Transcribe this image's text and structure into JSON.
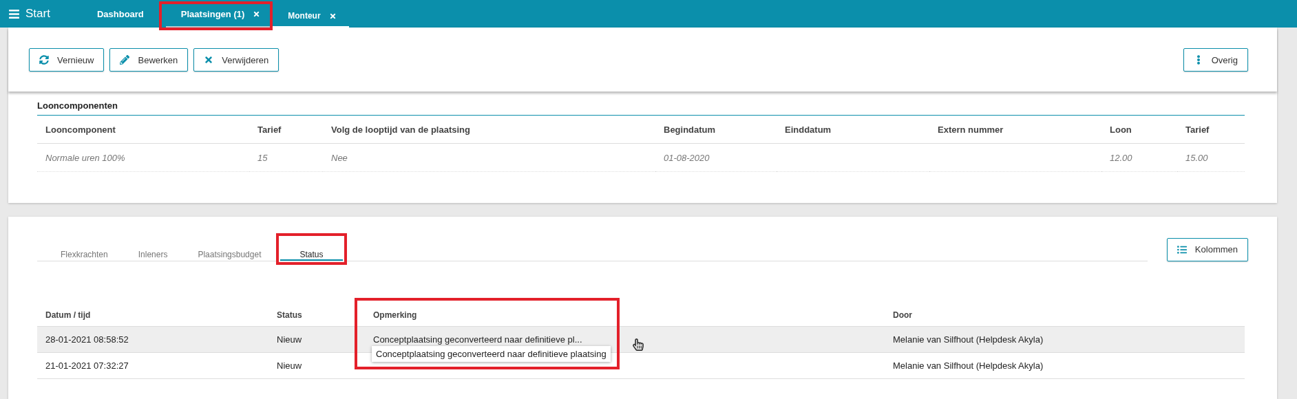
{
  "app_bar": {
    "menu_label": "Start",
    "tabs": [
      {
        "label": "Dashboard",
        "selected": false,
        "closable": false,
        "highlighted": false
      },
      {
        "label": "Plaatsingen (1)",
        "selected": false,
        "closable": true,
        "highlighted": true
      },
      {
        "label": "Monteur",
        "selected": true,
        "closable": true,
        "highlighted": false
      }
    ]
  },
  "toolbar": {
    "actions": [
      {
        "label": "Vernieuw"
      },
      {
        "label": "Bewerken"
      },
      {
        "label": "Verwijderen"
      }
    ],
    "more": {
      "label": "Overig"
    }
  },
  "loon_section": {
    "title": "Looncomponenten",
    "columns": [
      "Looncomponent",
      "Tarief",
      "Volg de looptijd van de plaatsing",
      "Begindatum",
      "Einddatum",
      "Extern nummer",
      "Loon",
      "Tarief"
    ],
    "rows": [
      {
        "cells": [
          "Normale uren 100%",
          "15",
          "Nee",
          "01-08-2020",
          null,
          null,
          "12.00",
          "15.00"
        ]
      }
    ]
  },
  "detail_section": {
    "tabs": [
      {
        "label": "Flexkrachten",
        "selected": false,
        "highlighted": false
      },
      {
        "label": "Inleners",
        "selected": false,
        "highlighted": false
      },
      {
        "label": "Plaatsingsbudget",
        "selected": false,
        "highlighted": false
      },
      {
        "label": "Status",
        "selected": true,
        "highlighted": true
      }
    ],
    "columns_button": {
      "label": "Kolommen"
    },
    "table": {
      "columns": [
        {
          "label": "Datum / tijd",
          "highlighted": false
        },
        {
          "label": "Status",
          "highlighted": false
        },
        {
          "label": "Opmerking",
          "highlighted": true
        },
        {
          "label": "Door",
          "highlighted": false
        }
      ],
      "rows": [
        {
          "cells": [
            "28-01-2021 08:58:52",
            "Nieuw",
            "Conceptplaatsing geconverteerd naar definitieve pl...",
            "Melanie van Silfhout (Helpdesk Akyla)"
          ],
          "hovered": true,
          "tooltip": "Conceptplaatsing geconverteerd naar definitieve plaatsing"
        },
        {
          "cells": [
            "21-01-2021 07:32:27",
            "Nieuw",
            null,
            "Melanie van Silfhout (Helpdesk Akyla)"
          ],
          "hovered": false
        }
      ]
    }
  }
}
